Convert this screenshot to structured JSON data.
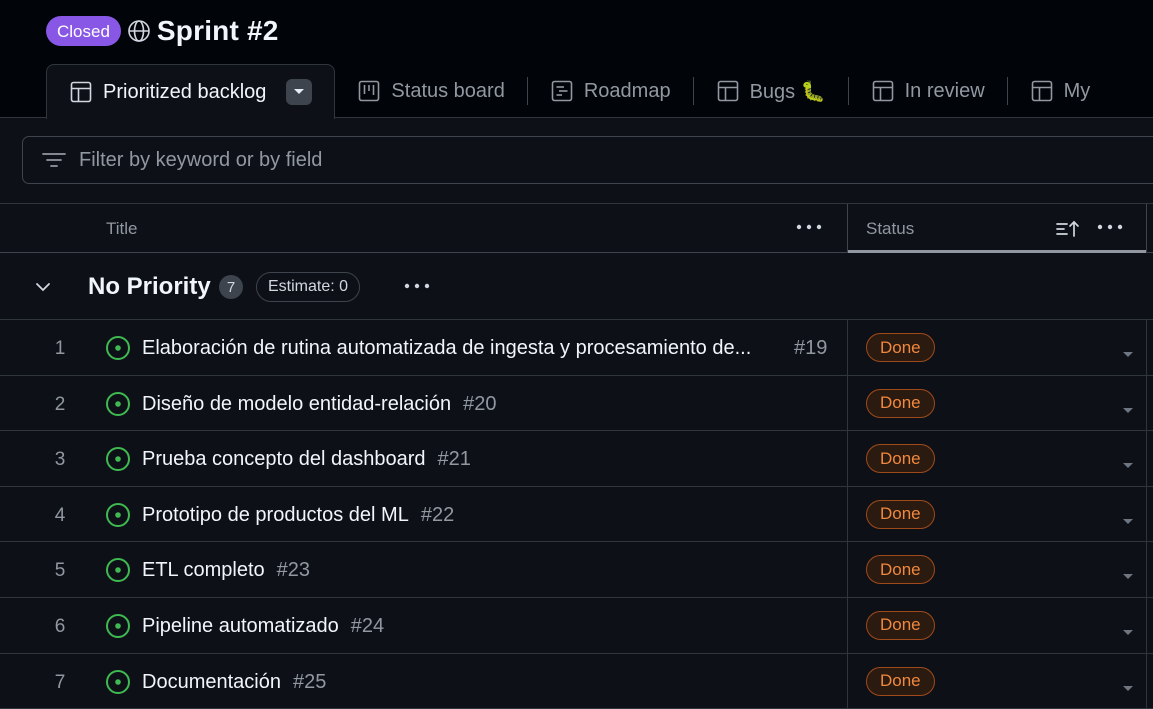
{
  "header": {
    "badge": "Closed",
    "title": "Sprint #2"
  },
  "tabs": [
    {
      "label": "Prioritized backlog",
      "icon": "table-icon",
      "active": true
    },
    {
      "label": "Status board",
      "icon": "board-icon"
    },
    {
      "label": "Roadmap",
      "icon": "roadmap-icon"
    },
    {
      "label": "Bugs 🐛",
      "icon": "table-icon"
    },
    {
      "label": "In review",
      "icon": "table-icon"
    },
    {
      "label": "My",
      "icon": "table-icon"
    }
  ],
  "filter": {
    "placeholder": "Filter by keyword or by field"
  },
  "columns": {
    "title": "Title",
    "status": "Status"
  },
  "group": {
    "name": "No Priority",
    "count": "7",
    "estimate": "Estimate: 0"
  },
  "rows": [
    {
      "num": "1",
      "title": "Elaboración de rutina automatizada de ingesta y procesamiento de...",
      "ref": "#19",
      "status": "Done"
    },
    {
      "num": "2",
      "title": "Diseño de modelo entidad-relación",
      "ref": "#20",
      "status": "Done"
    },
    {
      "num": "3",
      "title": "Prueba concepto del dashboard",
      "ref": "#21",
      "status": "Done"
    },
    {
      "num": "4",
      "title": "Prototipo de productos del ML",
      "ref": "#22",
      "status": "Done"
    },
    {
      "num": "5",
      "title": "ETL completo",
      "ref": "#23",
      "status": "Done"
    },
    {
      "num": "6",
      "title": "Pipeline automatizado",
      "ref": "#24",
      "status": "Done"
    },
    {
      "num": "7",
      "title": "Documentación",
      "ref": "#25",
      "status": "Done"
    }
  ],
  "colors": {
    "closed_badge": "#8957e5",
    "open_issue_icon": "#3fb950",
    "done_status": "#f0883e"
  }
}
